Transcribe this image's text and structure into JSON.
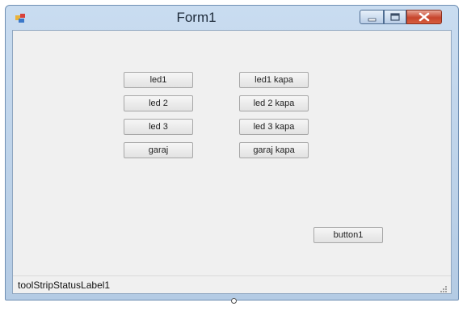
{
  "window": {
    "title": "Form1"
  },
  "buttons": {
    "led1": "led1",
    "led2": "led 2",
    "led3": "led 3",
    "garaj": "garaj",
    "led1_kapa": "led1 kapa",
    "led2_kapa": "led 2 kapa",
    "led3_kapa": "led 3 kapa",
    "garaj_kapa": "garaj kapa",
    "button1": "button1"
  },
  "status": {
    "label": "toolStripStatusLabel1"
  },
  "icons": {
    "app": "app-icon",
    "minimize": "minimize-icon",
    "maximize": "maximize-icon",
    "close": "close-icon",
    "size_grip": "size-grip-icon"
  },
  "colors": {
    "titlebar": "#c9dcf0",
    "client": "#f0f0f0",
    "close_button": "#c7452c"
  }
}
